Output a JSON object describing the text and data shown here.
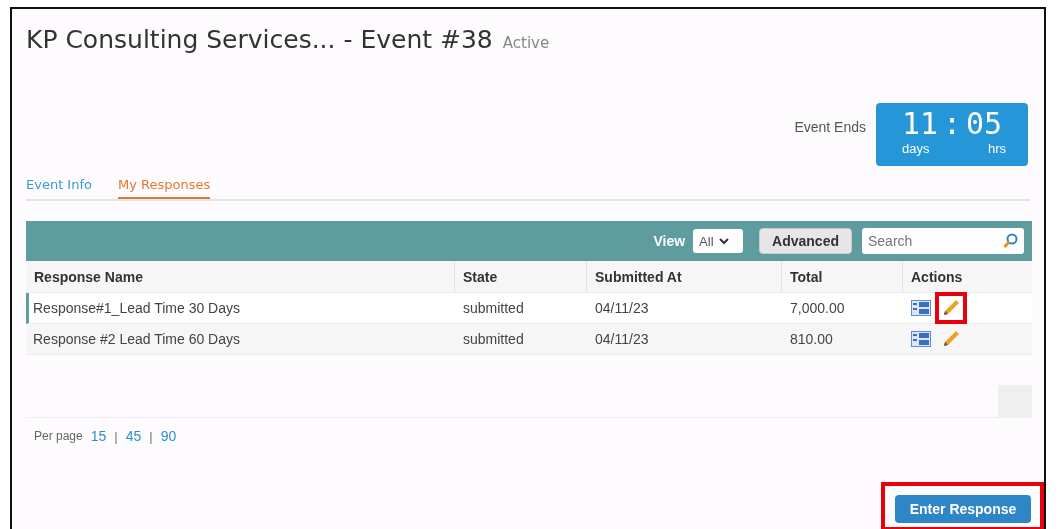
{
  "header": {
    "title": "KP Consulting Services... - Event #38",
    "status": "Active"
  },
  "timer": {
    "label": "Event Ends",
    "value_1": "11",
    "separator": ":",
    "value_2": "05",
    "unit_1": "days",
    "unit_2": "hrs"
  },
  "tabs": [
    {
      "label": "Event Info",
      "selected": false
    },
    {
      "label": "My Responses",
      "selected": true
    }
  ],
  "toolbar": {
    "view_label": "View",
    "view_value": "All",
    "advanced_button": "Advanced",
    "search": {
      "placeholder": "Search"
    }
  },
  "table": {
    "columns": [
      "Response Name",
      "State",
      "Submitted At",
      "Total",
      "Actions"
    ],
    "rows": [
      {
        "cells": [
          "Response#1_Lead Time 30 Days",
          "submitted",
          "04/11/23",
          "7,000.00"
        ],
        "selected": true,
        "edit_highlighted": true
      },
      {
        "cells": [
          "Response #2 Lead Time 60 Days",
          "submitted",
          "04/11/23",
          "810.00"
        ],
        "selected": false,
        "edit_highlighted": false
      }
    ]
  },
  "pagination": {
    "label": "Per page",
    "options": [
      "15",
      "45",
      "90"
    ],
    "separator": "|"
  },
  "enter_button": {
    "label": "Enter Response",
    "highlighted": true
  }
}
